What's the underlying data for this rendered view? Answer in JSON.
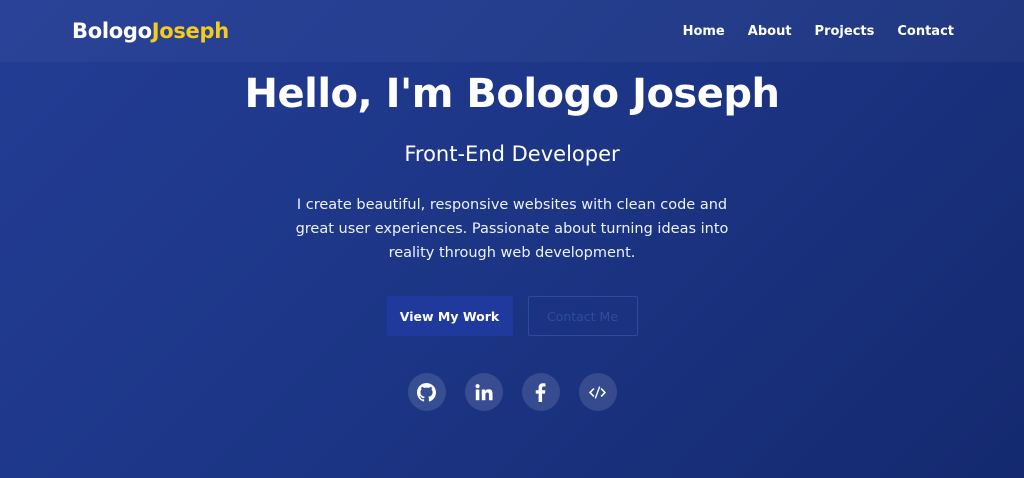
{
  "nav": {
    "logo_first": "Bologo",
    "logo_second": "Joseph",
    "links": [
      "Home",
      "About",
      "Projects",
      "Contact"
    ]
  },
  "hero": {
    "title": "Hello, I'm Bologo Joseph",
    "subtitle": "Front-End Developer",
    "description": "I create beautiful, responsive websites with clean code and great user experiences. Passionate about turning ideas into reality through web development.",
    "primary_button": "View My Work",
    "secondary_button": "Contact Me"
  },
  "socials": [
    {
      "icon": "github-icon"
    },
    {
      "icon": "linkedin-icon"
    },
    {
      "icon": "facebook-icon"
    },
    {
      "icon": "code-icon"
    }
  ],
  "colors": {
    "accent": "#f5cc1c",
    "background": "#1c3585",
    "primary_button": "#1f3a9c"
  }
}
